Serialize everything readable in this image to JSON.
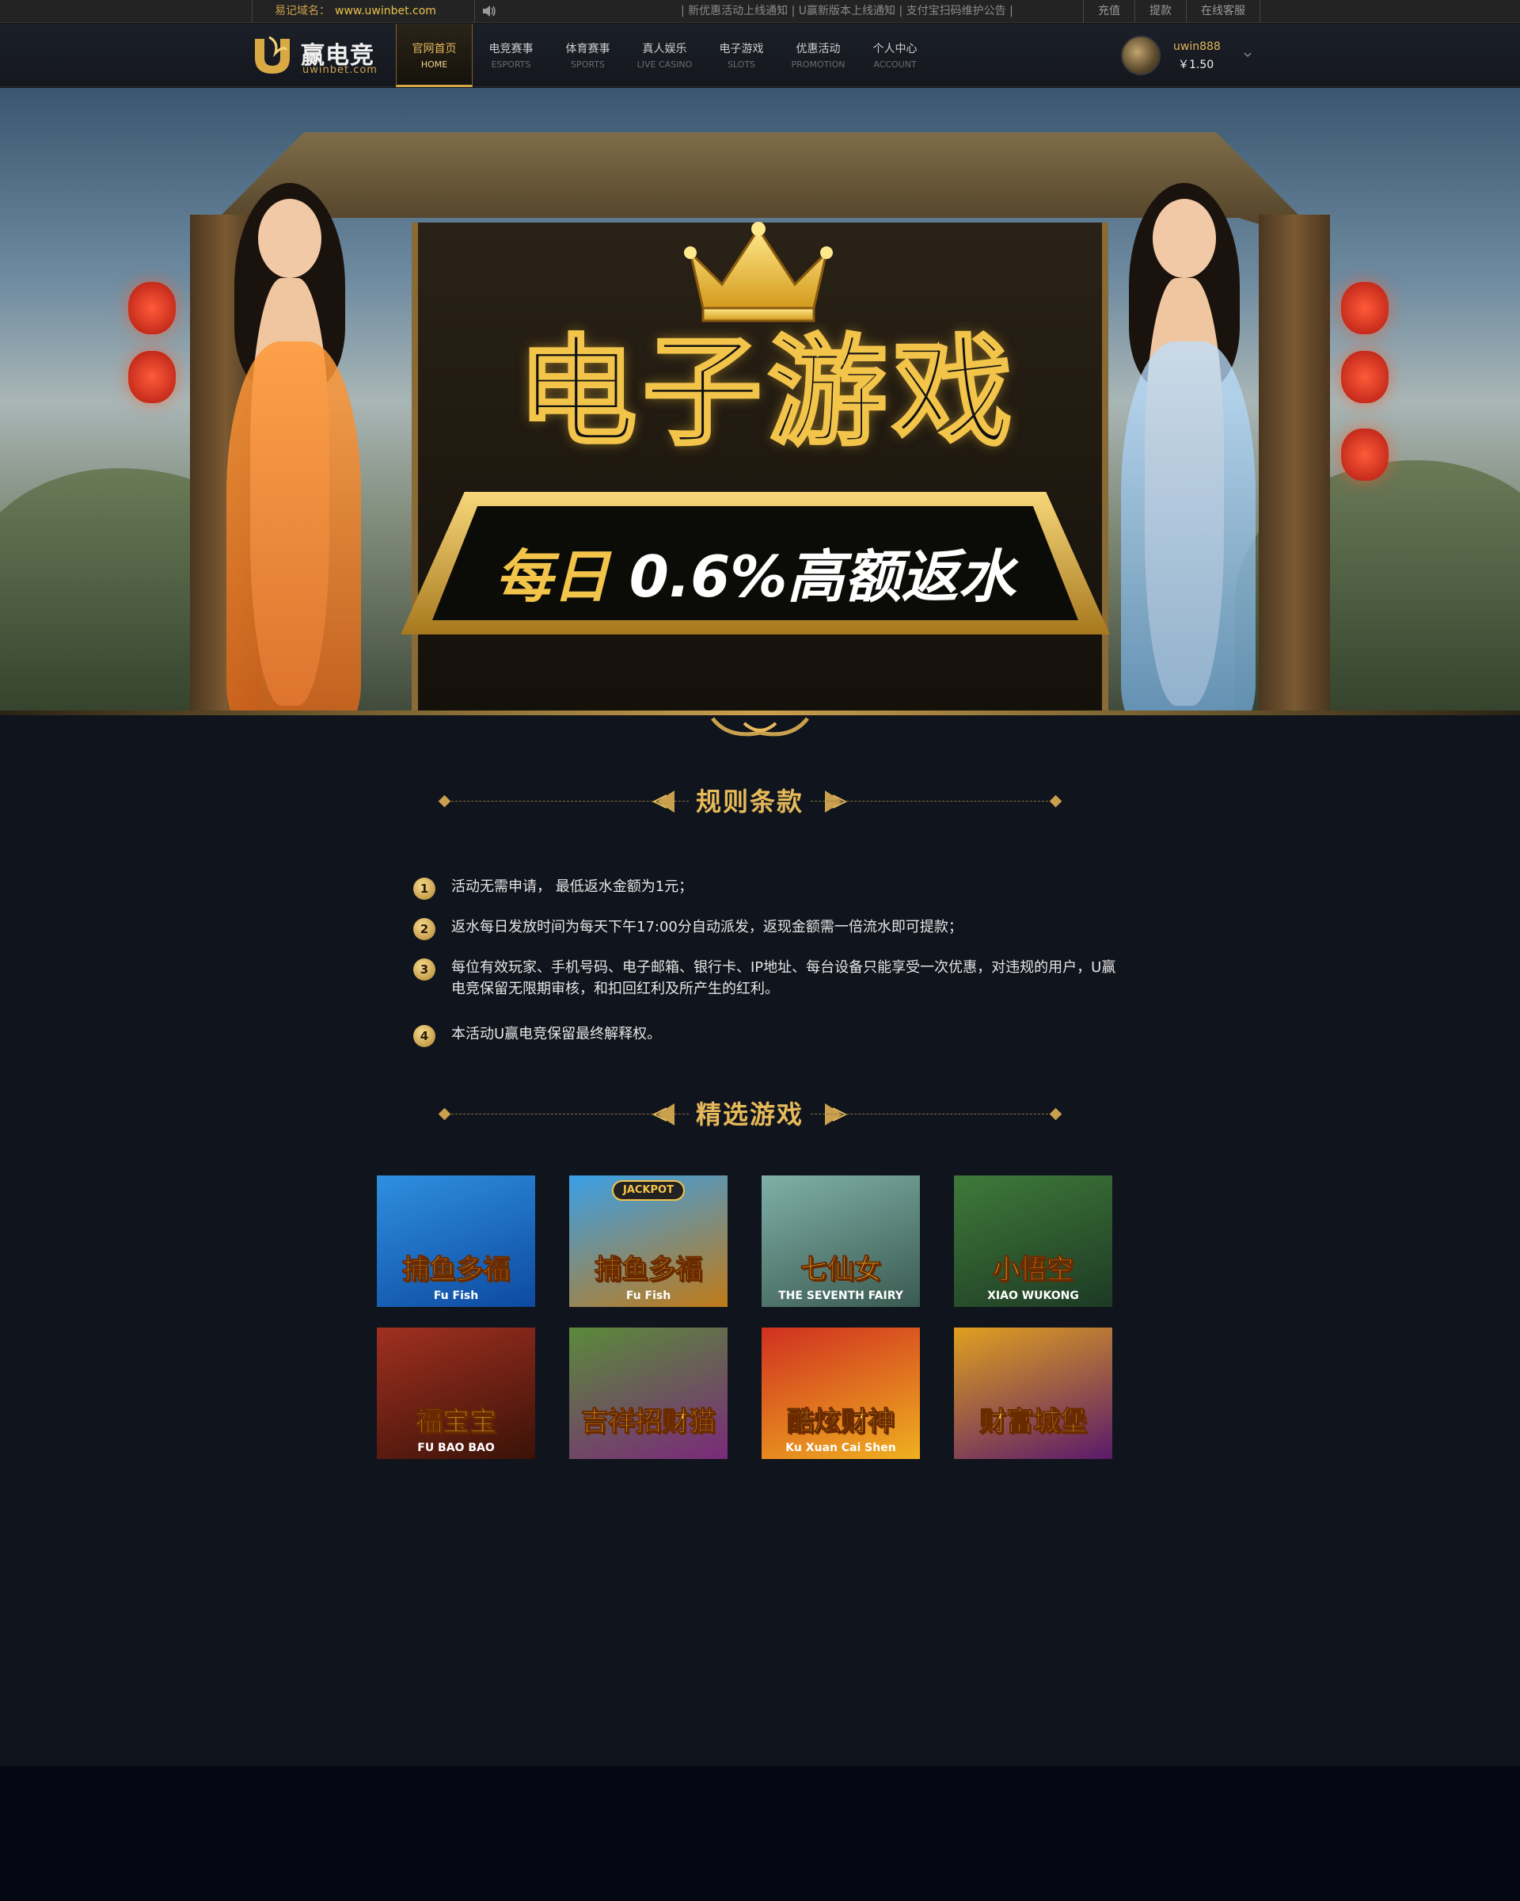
{
  "topbar": {
    "domain_label": "易记域名：",
    "domain_url": "www.uwinbet.com",
    "notice": "| 新优惠活动上线通知 | U赢新版本上线通知 | 支付宝扫码维护公告 |",
    "links": [
      "充值",
      "提款",
      "在线客服"
    ]
  },
  "logo": {
    "name": "赢电竞",
    "sub": "uwinbet.com"
  },
  "nav": [
    {
      "cn": "官网首页",
      "en": "HOME"
    },
    {
      "cn": "电竞赛事",
      "en": "ESPORTS"
    },
    {
      "cn": "体育赛事",
      "en": "SPORTS"
    },
    {
      "cn": "真人娱乐",
      "en": "LIVE CASINO"
    },
    {
      "cn": "电子游戏",
      "en": "SLOTS"
    },
    {
      "cn": "优惠活动",
      "en": "PROMOTION"
    },
    {
      "cn": "个人中心",
      "en": "ACCOUNT"
    }
  ],
  "user": {
    "name": "uwin888",
    "balance": "￥1.50"
  },
  "banner": {
    "title": "电子游戏",
    "plaque_gold": "每日",
    "plaque_white": "0.6%高额返水"
  },
  "sections": {
    "rules_title": "规则条款",
    "games_title": "精选游戏"
  },
  "rules": [
    {
      "num": "1",
      "text": "活动无需申请，  最低返水金额为1元；"
    },
    {
      "num": "2",
      "text": "返水每日发放时间为每天下午17:00分自动派发，返现金额需一倍流水即可提款；"
    },
    {
      "num": "3",
      "text": "每位有效玩家、手机号码、电子邮箱、银行卡、IP地址、每台设备只能享受一次优惠，对违规的用户，U赢电竞保留无限期审核，和扣回红利及所产生的红利。"
    },
    {
      "num": "4",
      "text": "本活动U赢电竞保留最终解释权。"
    }
  ],
  "games": [
    {
      "title": "捕鱼多福",
      "sub": "Fu Fish",
      "badge": "",
      "colors": [
        "#2f8fe0",
        "#0d4aa0"
      ]
    },
    {
      "title": "捕鱼多福",
      "sub": "Fu Fish",
      "badge": "JACKPOT",
      "colors": [
        "#3aa0e8",
        "#c07a18"
      ]
    },
    {
      "title": "七仙女",
      "sub": "THE SEVENTH FAIRY",
      "badge": "",
      "colors": [
        "#7fb0a8",
        "#3a5a50"
      ]
    },
    {
      "title": "小悟空",
      "sub": "XIAO WUKONG",
      "badge": "",
      "colors": [
        "#3f7a3a",
        "#1d3a24"
      ]
    },
    {
      "title": "福宝宝",
      "sub": "FU BAO BAO",
      "badge": "",
      "colors": [
        "#a03020",
        "#3a1208"
      ]
    },
    {
      "title": "吉祥招财猫",
      "sub": "",
      "badge": "",
      "colors": [
        "#5a8a3a",
        "#7a2a7a"
      ]
    },
    {
      "title": "酷炫财神",
      "sub": "Ku Xuan Cai Shen",
      "badge": "",
      "colors": [
        "#d03020",
        "#f0b020"
      ]
    },
    {
      "title": "财富城堡",
      "sub": "",
      "badge": "",
      "colors": [
        "#e0a020",
        "#5a1a6a"
      ]
    }
  ],
  "colors": {
    "accent": "#e2b65a",
    "background": "#10141c",
    "footer": "#050812"
  }
}
